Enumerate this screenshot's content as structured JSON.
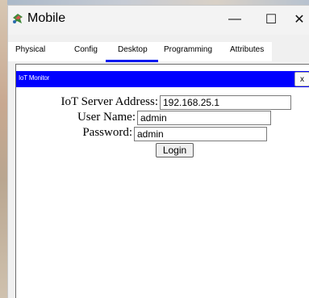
{
  "window": {
    "title": "Mobile",
    "minimize_glyph": "—",
    "maximize_glyph": "☐",
    "close_glyph": "✕"
  },
  "tabs": [
    {
      "label": "Physical",
      "selected": false
    },
    {
      "label": "Config",
      "selected": false
    },
    {
      "label": "Desktop",
      "selected": true
    },
    {
      "label": "Programming",
      "selected": false
    },
    {
      "label": "Attributes",
      "selected": false
    }
  ],
  "app": {
    "title": "IoT Monitor",
    "close_label": "x"
  },
  "form": {
    "server_label": "IoT Server Address:",
    "server_value": "192.168.25.1",
    "user_label": "User Name:",
    "user_value": "admin",
    "password_label": "Password:",
    "password_value": "admin",
    "login_label": "Login"
  },
  "colors": {
    "accent_blue": "#0000ff",
    "tab_underline": "#0018f0"
  },
  "icons": {
    "app": "packet-tracer-device-icon"
  }
}
